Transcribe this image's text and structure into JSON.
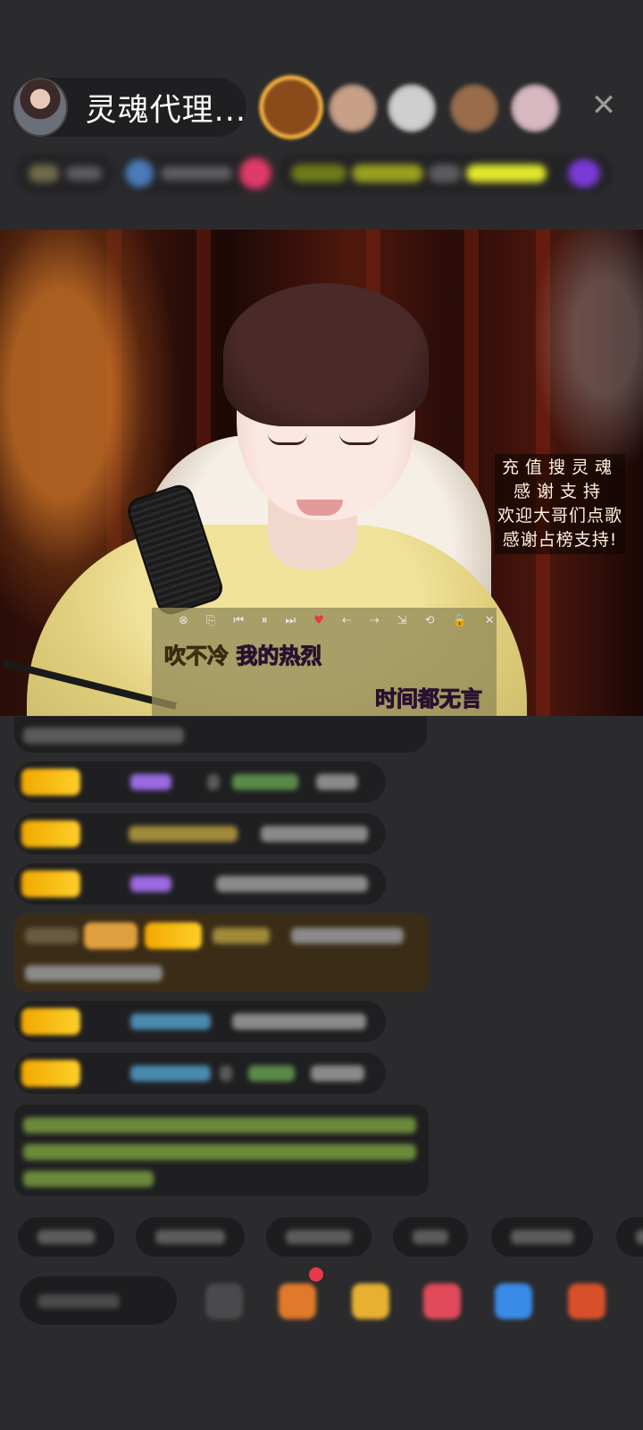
{
  "header": {
    "host_name": "灵魂代理...",
    "close_label": "✕",
    "viewer_avatar_colors": [
      "#b07850",
      "#c8a088",
      "#cfcfcf",
      "#9a6c4a",
      "#d8b8c0"
    ],
    "info_chip_colors": [
      "#6e6a4a",
      "#5c5c60",
      "#4a7ab8",
      "#5c5c60",
      "#e03a6a",
      "#6f7a1a",
      "#e1e82a",
      "#5c5c60",
      "#9aa020",
      "#7a3ad8"
    ]
  },
  "video": {
    "notice_lines": [
      "充值搜灵魂",
      "感谢支持",
      "欢迎大哥们点歌",
      "感谢占榜支持!"
    ],
    "player_controls": [
      "⊗",
      "⎘",
      "⏮",
      "⏸",
      "⏭",
      "♥",
      "⇠",
      "⇢",
      "⇲",
      "⟲",
      "🔒",
      "✕"
    ],
    "lyrics": {
      "line1_sung": "吹不冷",
      "line1_next": "我的热烈",
      "line2": "时间都无言"
    }
  },
  "chat": {
    "badge_color": "#f4b400",
    "gem_colors": [
      "#b23ae0",
      "#e08a30",
      "#b23ae0",
      "#9a98c8",
      "#9a98c8"
    ],
    "highlight_bg": "#3b2c17",
    "system_text_color": "#8ab048"
  },
  "bottom": {
    "tool_icon_colors": [
      "#4a4a4c",
      "#e07a2a",
      "#e8b030",
      "#e04a5a",
      "#3a8ae8",
      "#d8502a"
    ]
  }
}
